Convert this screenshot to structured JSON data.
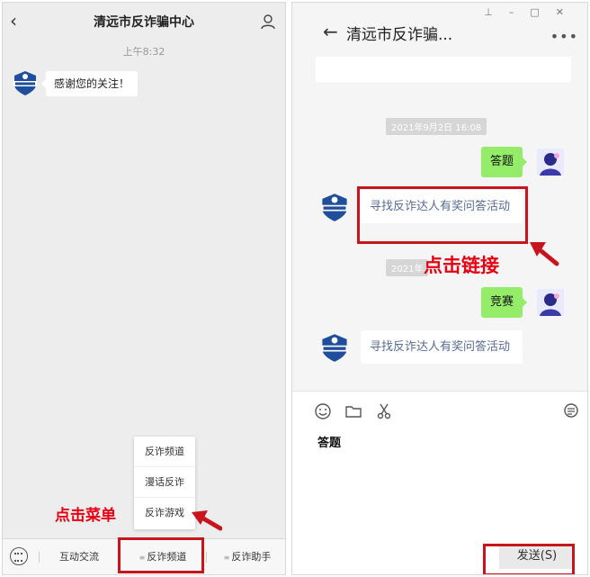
{
  "mobile": {
    "title": "清远市反诈骗中心",
    "time": "上午8:32",
    "greeting": "感谢您的关注！",
    "popup_items": [
      "反诈频道",
      "漫话反诈",
      "反诈游戏"
    ],
    "menu": {
      "item1": "互动交流",
      "item2": "反诈频道",
      "item3": "反诈助手"
    },
    "annotation": "点击菜单"
  },
  "desktop": {
    "title": "清远市反诈骗...",
    "timestamps": [
      "2021年9月2日 16:08",
      "2021年"
    ],
    "messages": {
      "answer": "答题",
      "contest": "竞赛",
      "link1": "寻找反诈达人有奖问答活动",
      "link2": "寻找反诈达人有奖问答活动"
    },
    "annotation": "点击链接",
    "input_draft": "答题",
    "send_label": "发送(S)"
  },
  "colors": {
    "annotation_red": "#e60012",
    "highlight_box": "#c8141d",
    "bubble_green": "#95ec69",
    "link_blue": "#576b95"
  },
  "icons": [
    "back-icon",
    "person-icon",
    "keyboard-icon",
    "emoji-icon",
    "folder-icon",
    "scissors-icon",
    "chat-history-icon",
    "more-icon",
    "pin-icon",
    "minimize-icon",
    "maximize-icon",
    "close-icon"
  ]
}
